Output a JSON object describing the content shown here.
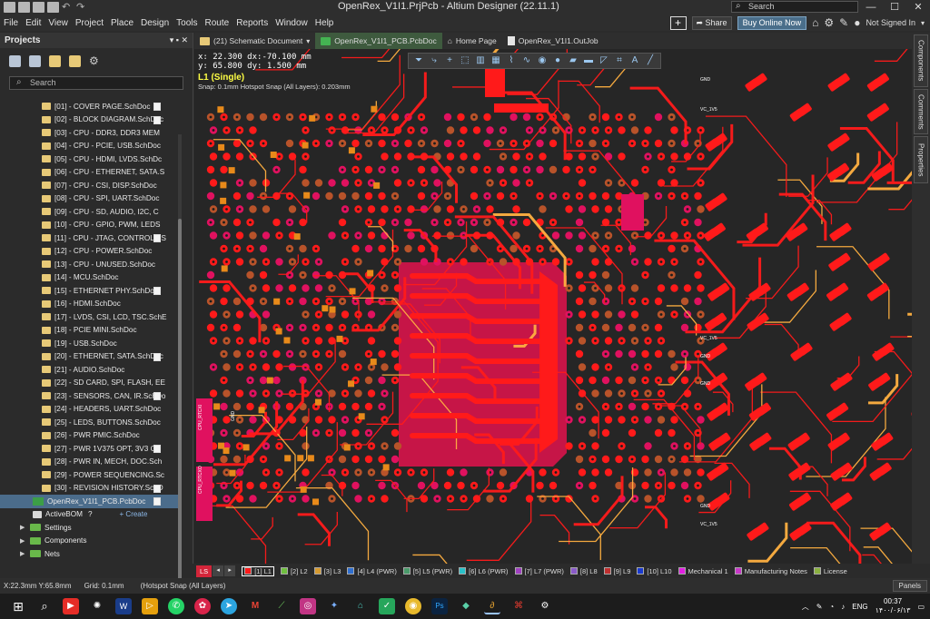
{
  "window": {
    "title": "OpenRex_V1I1.PrjPcb - Altium Designer (22.11.1)",
    "search_placeholder": "Search",
    "controls": [
      "—",
      "☐",
      "✕"
    ]
  },
  "menu": [
    "File",
    "Edit",
    "View",
    "Project",
    "Place",
    "Design",
    "Tools",
    "Route",
    "Reports",
    "Window",
    "Help"
  ],
  "header_right": {
    "share_label": "Share",
    "buy_label": "Buy Online Now",
    "signed_in_label": "Not Signed In"
  },
  "panel": {
    "title": "Projects",
    "controls": "▾ ▪ ✕",
    "search_placeholder": "Search",
    "schematics": [
      "[01] - COVER PAGE.SchDoc",
      "[02] - BLOCK DIAGRAM.SchDoc",
      "[03] - CPU - DDR3, DDR3 MEM",
      "[04] - CPU - PCIE, USB.SchDoc",
      "[05] - CPU - HDMI, LVDS.SchDc",
      "[06] - CPU - ETHERNET, SATA.S",
      "[07] - CPU - CSI, DISP.SchDoc",
      "[08] - CPU - SPI, UART.SchDoc",
      "[09] - CPU - SD, AUDIO, I2C, C",
      "[10] - CPU - GPIO, PWM, LEDS",
      "[11] - CPU - JTAG, CONTROLS.S",
      "[12] - CPU - POWER.SchDoc",
      "[13] - CPU - UNUSED.SchDoc",
      "[14] - MCU.SchDoc",
      "[15] - ETHERNET PHY.SchDoc",
      "[16] - HDMI.SchDoc",
      "[17] - LVDS, CSI, LCD, TSC.SchE",
      "[18] - PCIE MINI.SchDoc",
      "[19] - USB.SchDoc",
      "[20] - ETHERNET, SATA.SchDoc",
      "[21] - AUDIO.SchDoc",
      "[22] - SD CARD, SPI, FLASH, EE",
      "[23] - SENSORS, CAN, IR.SchDo",
      "[24] - HEADERS, UART.SchDoc",
      "[25] - LEDS, BUTTONS.SchDoc",
      "[26] - PWR PMIC.SchDoc",
      "[27] - PWR 1V375 OPT, 3V3 OF",
      "[28] - PWR IN, MECH, DOC.Sch",
      "[29] - POWER SEQUENCING.Sc",
      "[30] - REVISION HISTORY.SchD"
    ],
    "pcb_doc": "OpenRex_V1I1_PCB.PcbDoc",
    "active_bom": "ActiveBOM",
    "create_label": "+ Create",
    "folders": [
      "Settings",
      "Components",
      "Nets"
    ]
  },
  "tabs": [
    {
      "label": "(21) Schematic Document",
      "active": false
    },
    {
      "label": "OpenRex_V1I1_PCB.PcbDoc",
      "active": true
    },
    {
      "label": "Home Page",
      "active": false
    },
    {
      "label": "OpenRex_V1I1.OutJob",
      "active": false
    }
  ],
  "canvas": {
    "coord_line1": "x: 22.300   dx:-70.100 mm",
    "coord_line2": "y: 65.800   dy:  1.500  mm",
    "layer_indicator": "L1 (Single)",
    "snap_text": "Snap: 0.1mm Hotspot Snap (All Layers): 0.203mm",
    "net_labels": [
      "GND",
      "VC_1V5",
      "GND",
      "VC_1V5",
      "GND",
      "VC_1V5",
      "GND"
    ],
    "left_labels": [
      "CPU_RTCXI",
      "CPU_RTCXO",
      "GND"
    ],
    "trace_color": "#ff1a1a",
    "pad_color": "#e0115f"
  },
  "side_tabs": [
    "Components",
    "Comments",
    "Properties"
  ],
  "layers": {
    "ls_label": "LS",
    "items": [
      {
        "label": "[1] L1",
        "color": "#ff1a1a",
        "active": true
      },
      {
        "label": "[2] L2",
        "color": "#6fbf3f",
        "active": false
      },
      {
        "label": "[3] L3",
        "color": "#d59a30",
        "active": false
      },
      {
        "label": "[4] L4 (PWR)",
        "color": "#2f6fd0",
        "active": false
      },
      {
        "label": "[5] L5 (PWR)",
        "color": "#4a9a6a",
        "active": false
      },
      {
        "label": "[6] L6 (PWR)",
        "color": "#2ac0c8",
        "active": false
      },
      {
        "label": "[7] L7 (PWR)",
        "color": "#a040c0",
        "active": false
      },
      {
        "label": "[8] L8",
        "color": "#8a5ac8",
        "active": false
      },
      {
        "label": "[9] L9",
        "color": "#c03030",
        "active": false
      },
      {
        "label": "[10] L10",
        "color": "#1a3ad0",
        "active": false
      },
      {
        "label": "Mechanical 1",
        "color": "#e020e0",
        "active": false
      },
      {
        "label": "Manufacturing Notes",
        "color": "#c838c8",
        "active": false
      },
      {
        "label": "License",
        "color": "#8ab040",
        "active": false
      }
    ]
  },
  "status": {
    "coords": "X:22.3mm Y:65.8mm",
    "grid": "Grid: 0.1mm",
    "snap": "(Hotspot Snap (All Layers)",
    "panels_label": "Panels"
  },
  "taskbar": {
    "lang": "ENG",
    "time": "00:37",
    "date": "۱۴۰۰/۰۶/۱۳"
  }
}
